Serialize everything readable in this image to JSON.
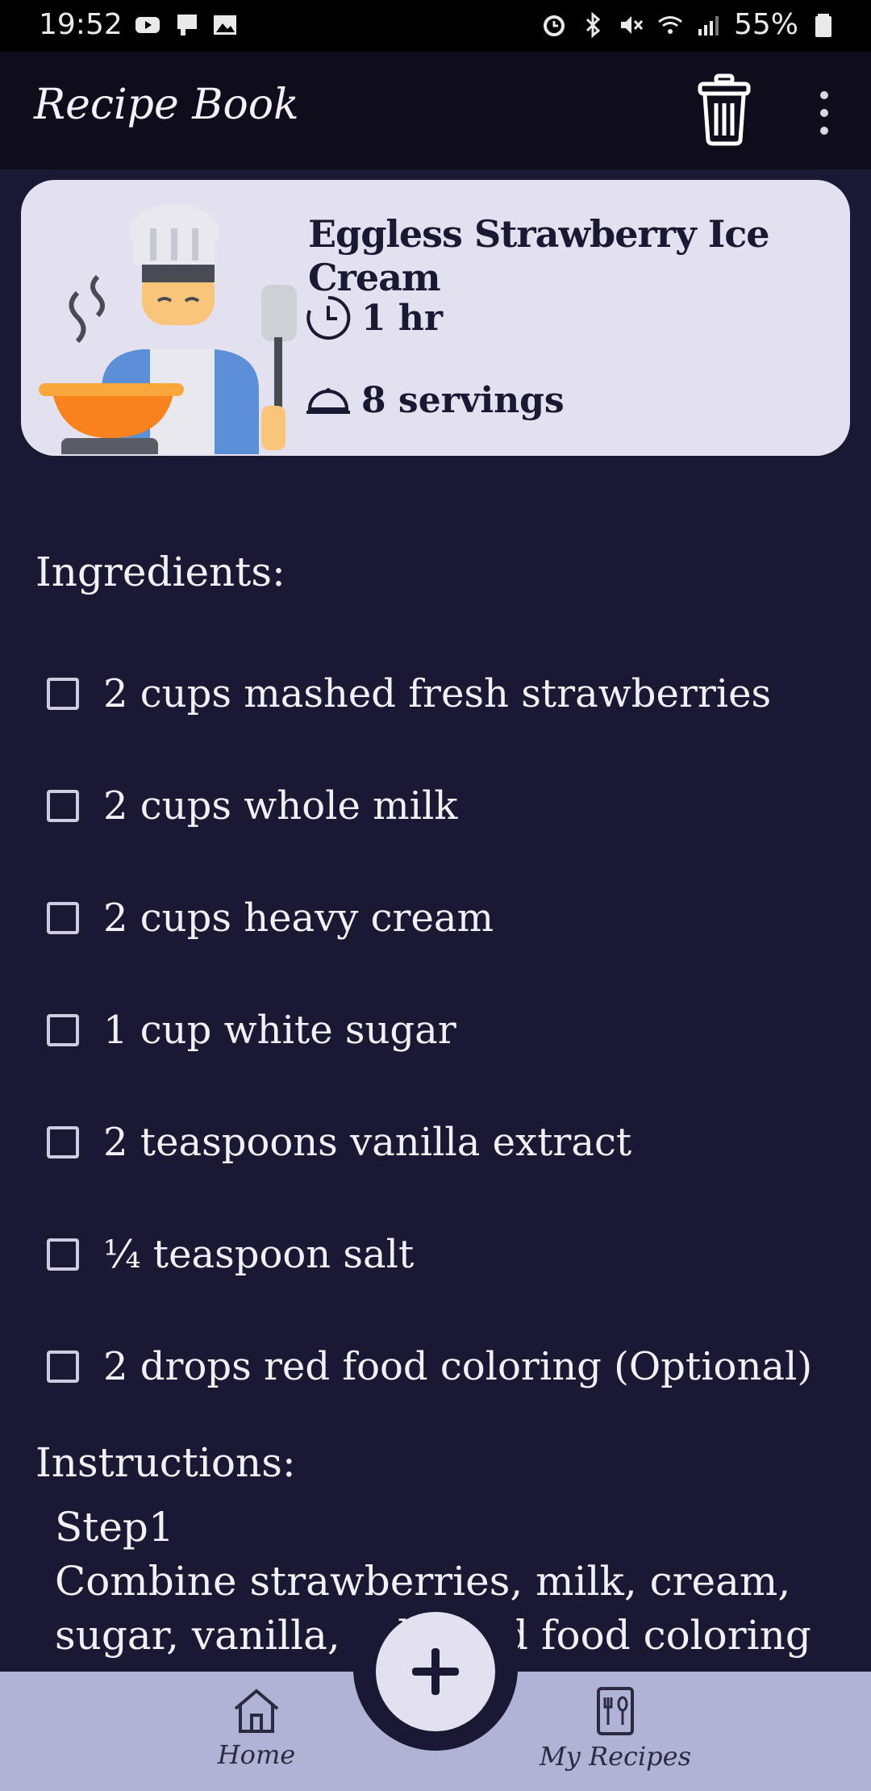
{
  "status_bar": {
    "time": "19:52",
    "battery": "55%",
    "left_icons": [
      "youtube-icon",
      "cast-icon",
      "image-icon"
    ],
    "right_icons": [
      "alarm-icon",
      "bluetooth-icon",
      "mute-icon",
      "wifi-icon",
      "signal-icon",
      "battery-icon"
    ]
  },
  "app_bar": {
    "title": "Recipe Book",
    "actions": [
      "trash-icon",
      "more-vert-icon"
    ]
  },
  "recipe": {
    "title": "Eggless Strawberry Ice Cream",
    "time": "1 hr",
    "servings": "8 servings",
    "image": "chef-icon"
  },
  "ingredients": {
    "label": "Ingredients:",
    "items": [
      "2 cups mashed fresh strawberries",
      "2 cups whole milk",
      "2 cups heavy cream",
      "1 cup white sugar",
      "2 teaspoons vanilla extract",
      "¼ teaspoon salt",
      "2 drops red food coloring (Optional)"
    ]
  },
  "instructions": {
    "label": "Instructions:",
    "step_title": "Step1",
    "step_text": "Combine strawberries, milk, cream, sugar, vanilla, salt, and food coloring in a large bowl."
  },
  "bottom_nav": {
    "home_label": "Home",
    "my_recipes_label": "My Recipes",
    "fab": "plus-icon"
  },
  "colors": {
    "background": "#1b1833",
    "app_bar": "#0f0d1c",
    "card": "#e3e0ef",
    "bottom_nav": "#b1b3d6"
  }
}
